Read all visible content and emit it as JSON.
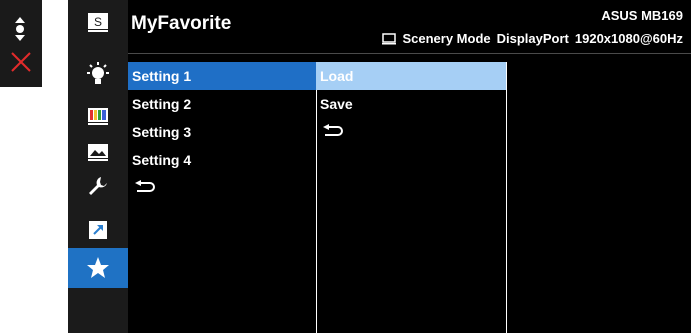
{
  "osd": {
    "title": "MyFavorite",
    "model": "ASUS MB169",
    "status": {
      "mode": "Scenery Mode",
      "input": "DisplayPort",
      "resolution": "1920x1080@60Hz"
    },
    "side_icons": [
      "splendid-icon",
      "bluelight-icon",
      "color-icon",
      "image-icon",
      "system-setup-icon",
      "shortcut-icon",
      "favorite-star-icon"
    ],
    "active_icon": "favorite-star-icon",
    "settings": [
      "Setting 1",
      "Setting 2",
      "Setting 3",
      "Setting 4"
    ],
    "selected_setting": "Setting 1",
    "actions": [
      "Load",
      "Save"
    ],
    "selected_action": "Load"
  },
  "colors": {
    "highlight_blue": "#1f6fc6",
    "highlight_light_blue": "#a6cff5",
    "osd_background": "#000000"
  }
}
